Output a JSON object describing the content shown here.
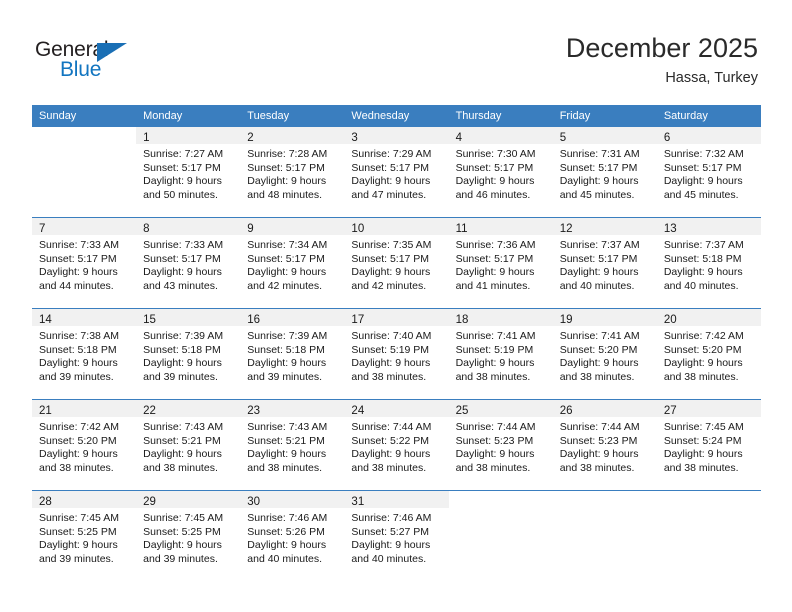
{
  "brand": {
    "name_part1": "General",
    "name_part2": "Blue",
    "triangle_color": "#1a6fb5",
    "blue_color": "#1275c0"
  },
  "header": {
    "title": "December 2025",
    "subtitle": "Hassa, Turkey",
    "header_bg_color": "#3a7ebf",
    "daynum_band_color": "#f1f1f1"
  },
  "weekday_headers": [
    "Sunday",
    "Monday",
    "Tuesday",
    "Wednesday",
    "Thursday",
    "Friday",
    "Saturday"
  ],
  "weeks": [
    [
      {
        "day": "",
        "lines": []
      },
      {
        "day": "1",
        "lines": [
          "Sunrise: 7:27 AM",
          "Sunset: 5:17 PM",
          "Daylight: 9 hours",
          "and 50 minutes."
        ]
      },
      {
        "day": "2",
        "lines": [
          "Sunrise: 7:28 AM",
          "Sunset: 5:17 PM",
          "Daylight: 9 hours",
          "and 48 minutes."
        ]
      },
      {
        "day": "3",
        "lines": [
          "Sunrise: 7:29 AM",
          "Sunset: 5:17 PM",
          "Daylight: 9 hours",
          "and 47 minutes."
        ]
      },
      {
        "day": "4",
        "lines": [
          "Sunrise: 7:30 AM",
          "Sunset: 5:17 PM",
          "Daylight: 9 hours",
          "and 46 minutes."
        ]
      },
      {
        "day": "5",
        "lines": [
          "Sunrise: 7:31 AM",
          "Sunset: 5:17 PM",
          "Daylight: 9 hours",
          "and 45 minutes."
        ]
      },
      {
        "day": "6",
        "lines": [
          "Sunrise: 7:32 AM",
          "Sunset: 5:17 PM",
          "Daylight: 9 hours",
          "and 45 minutes."
        ]
      }
    ],
    [
      {
        "day": "7",
        "lines": [
          "Sunrise: 7:33 AM",
          "Sunset: 5:17 PM",
          "Daylight: 9 hours",
          "and 44 minutes."
        ]
      },
      {
        "day": "8",
        "lines": [
          "Sunrise: 7:33 AM",
          "Sunset: 5:17 PM",
          "Daylight: 9 hours",
          "and 43 minutes."
        ]
      },
      {
        "day": "9",
        "lines": [
          "Sunrise: 7:34 AM",
          "Sunset: 5:17 PM",
          "Daylight: 9 hours",
          "and 42 minutes."
        ]
      },
      {
        "day": "10",
        "lines": [
          "Sunrise: 7:35 AM",
          "Sunset: 5:17 PM",
          "Daylight: 9 hours",
          "and 42 minutes."
        ]
      },
      {
        "day": "11",
        "lines": [
          "Sunrise: 7:36 AM",
          "Sunset: 5:17 PM",
          "Daylight: 9 hours",
          "and 41 minutes."
        ]
      },
      {
        "day": "12",
        "lines": [
          "Sunrise: 7:37 AM",
          "Sunset: 5:17 PM",
          "Daylight: 9 hours",
          "and 40 minutes."
        ]
      },
      {
        "day": "13",
        "lines": [
          "Sunrise: 7:37 AM",
          "Sunset: 5:18 PM",
          "Daylight: 9 hours",
          "and 40 minutes."
        ]
      }
    ],
    [
      {
        "day": "14",
        "lines": [
          "Sunrise: 7:38 AM",
          "Sunset: 5:18 PM",
          "Daylight: 9 hours",
          "and 39 minutes."
        ]
      },
      {
        "day": "15",
        "lines": [
          "Sunrise: 7:39 AM",
          "Sunset: 5:18 PM",
          "Daylight: 9 hours",
          "and 39 minutes."
        ]
      },
      {
        "day": "16",
        "lines": [
          "Sunrise: 7:39 AM",
          "Sunset: 5:18 PM",
          "Daylight: 9 hours",
          "and 39 minutes."
        ]
      },
      {
        "day": "17",
        "lines": [
          "Sunrise: 7:40 AM",
          "Sunset: 5:19 PM",
          "Daylight: 9 hours",
          "and 38 minutes."
        ]
      },
      {
        "day": "18",
        "lines": [
          "Sunrise: 7:41 AM",
          "Sunset: 5:19 PM",
          "Daylight: 9 hours",
          "and 38 minutes."
        ]
      },
      {
        "day": "19",
        "lines": [
          "Sunrise: 7:41 AM",
          "Sunset: 5:20 PM",
          "Daylight: 9 hours",
          "and 38 minutes."
        ]
      },
      {
        "day": "20",
        "lines": [
          "Sunrise: 7:42 AM",
          "Sunset: 5:20 PM",
          "Daylight: 9 hours",
          "and 38 minutes."
        ]
      }
    ],
    [
      {
        "day": "21",
        "lines": [
          "Sunrise: 7:42 AM",
          "Sunset: 5:20 PM",
          "Daylight: 9 hours",
          "and 38 minutes."
        ]
      },
      {
        "day": "22",
        "lines": [
          "Sunrise: 7:43 AM",
          "Sunset: 5:21 PM",
          "Daylight: 9 hours",
          "and 38 minutes."
        ]
      },
      {
        "day": "23",
        "lines": [
          "Sunrise: 7:43 AM",
          "Sunset: 5:21 PM",
          "Daylight: 9 hours",
          "and 38 minutes."
        ]
      },
      {
        "day": "24",
        "lines": [
          "Sunrise: 7:44 AM",
          "Sunset: 5:22 PM",
          "Daylight: 9 hours",
          "and 38 minutes."
        ]
      },
      {
        "day": "25",
        "lines": [
          "Sunrise: 7:44 AM",
          "Sunset: 5:23 PM",
          "Daylight: 9 hours",
          "and 38 minutes."
        ]
      },
      {
        "day": "26",
        "lines": [
          "Sunrise: 7:44 AM",
          "Sunset: 5:23 PM",
          "Daylight: 9 hours",
          "and 38 minutes."
        ]
      },
      {
        "day": "27",
        "lines": [
          "Sunrise: 7:45 AM",
          "Sunset: 5:24 PM",
          "Daylight: 9 hours",
          "and 38 minutes."
        ]
      }
    ],
    [
      {
        "day": "28",
        "lines": [
          "Sunrise: 7:45 AM",
          "Sunset: 5:25 PM",
          "Daylight: 9 hours",
          "and 39 minutes."
        ]
      },
      {
        "day": "29",
        "lines": [
          "Sunrise: 7:45 AM",
          "Sunset: 5:25 PM",
          "Daylight: 9 hours",
          "and 39 minutes."
        ]
      },
      {
        "day": "30",
        "lines": [
          "Sunrise: 7:46 AM",
          "Sunset: 5:26 PM",
          "Daylight: 9 hours",
          "and 40 minutes."
        ]
      },
      {
        "day": "31",
        "lines": [
          "Sunrise: 7:46 AM",
          "Sunset: 5:27 PM",
          "Daylight: 9 hours",
          "and 40 minutes."
        ]
      },
      {
        "day": "",
        "lines": []
      },
      {
        "day": "",
        "lines": []
      },
      {
        "day": "",
        "lines": []
      }
    ]
  ]
}
